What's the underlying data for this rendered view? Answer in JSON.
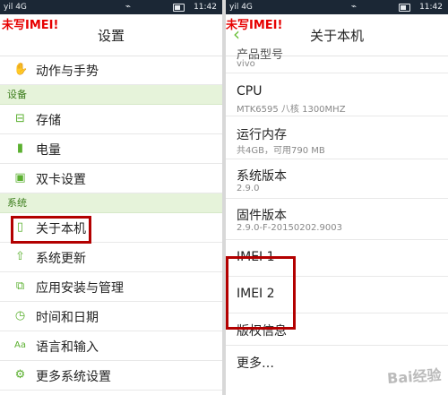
{
  "status_bar": {
    "signal": "yil 4G",
    "time": "11:42"
  },
  "annotation": "未写IMEI!",
  "left": {
    "title": "设置",
    "items": [
      {
        "label": "动作与手势",
        "icon": "gesture-icon"
      },
      {
        "section": "设备"
      },
      {
        "label": "存储",
        "icon": "storage-icon"
      },
      {
        "label": "电量",
        "icon": "battery-icon"
      },
      {
        "label": "双卡设置",
        "icon": "dual-sim-icon"
      },
      {
        "section": "系统"
      },
      {
        "label": "关于本机",
        "icon": "phone-info-icon"
      },
      {
        "label": "系统更新",
        "icon": "update-icon"
      },
      {
        "label": "应用安装与管理",
        "icon": "apps-icon"
      },
      {
        "label": "时间和日期",
        "icon": "clock-icon"
      },
      {
        "label": "语言和输入",
        "icon": "language-icon"
      },
      {
        "label": "更多系统设置",
        "icon": "gear-icon"
      }
    ]
  },
  "right": {
    "title": "关于本机",
    "back_icon": "chevron-left-icon",
    "rows": [
      {
        "title": "产品型号",
        "value": "vivo"
      },
      {
        "title": "CPU",
        "value": "MTK6595 八核 1300MHZ"
      },
      {
        "title": "运行内存",
        "value": "共4GB，可用790 MB"
      },
      {
        "title": "系统版本",
        "value": "2.9.0"
      },
      {
        "title": "固件版本",
        "value": "2.9.0-F-20150202.9003"
      },
      {
        "title": "IMEI 1",
        "value": ""
      },
      {
        "title": "IMEI 2",
        "value": ""
      },
      {
        "title": "版权信息",
        "value": ""
      },
      {
        "title": "更多…",
        "value": ""
      }
    ]
  },
  "watermark": "Bai经验"
}
